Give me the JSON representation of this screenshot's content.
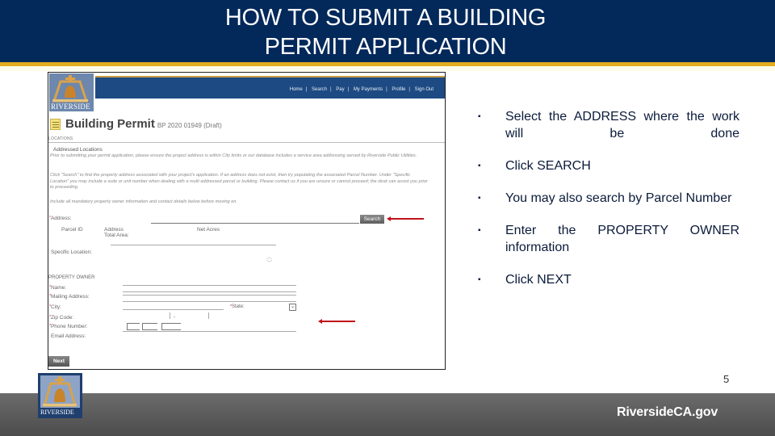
{
  "slide": {
    "title_line1": "HOW TO SUBMIT A BUILDING",
    "title_line2": "PERMIT APPLICATION",
    "page_number": "5",
    "footer_url": "RiversideCA.gov",
    "footer_logo_text": "RIVERSIDE",
    "colors": {
      "banner": "#03285a",
      "gold": "#e2ac1f",
      "footer": "#5c5c5c",
      "arrow": "#c0141a"
    }
  },
  "screenshot": {
    "logo_text": "RIVERSIDE",
    "nav_links": [
      "Home",
      "Search",
      "Pay",
      "My Payments",
      "Profile",
      "Sign Out"
    ],
    "nav_separator": "|",
    "page_title": "Building Permit",
    "record_id": "BP 2020 01949 (Draft)",
    "section_locations": "LOCATIONS",
    "subsection_addressed": "Addressed Locations",
    "instructions": [
      "Prior to submitting your permit application, please ensure the project address is within City limits or our database includes a service area addressing served by Riverside Public Utilities.",
      "Click \"Search\" to find the property address associated with your project's application. If an address does not exist, then try populating the associated Parcel Number. Under \"Specific Location\" you may include a suite or unit number when dealing with a multi addressed parcel or building. Please contact us if you are unsure or cannot proceed; the desk can assist you prior to proceeding.",
      "Include all mandatory property owner information and contact details below before moving on."
    ],
    "address_label": "Address:",
    "search_button": "Search",
    "col_parcel_id": "Parcel ID",
    "col_address": "Address",
    "col_total_area": "Total Area:",
    "col_net_acres": "Net Acres",
    "specific_location_label": "Specific Location:",
    "property_owner_heading": "PROPERTY OWNER",
    "owner_fields": {
      "name": "Name:",
      "mailing_address": "Mailing Address:",
      "city": "City:",
      "state": "State:",
      "zip": "Zip Code:",
      "phone": "Phone Number:",
      "email": "Email Address:"
    },
    "zip_dash": "-",
    "state_dropdown_icon": "chevron-down",
    "next_button": "Next",
    "required_marker": "*"
  },
  "instructions_list": [
    "Select the ADDRESS where the work will be done",
    "Click SEARCH",
    "You may also search by Parcel Number",
    "Enter the PROPERTY OWNER information",
    "Click NEXT"
  ],
  "bullet_glyph": "▪"
}
